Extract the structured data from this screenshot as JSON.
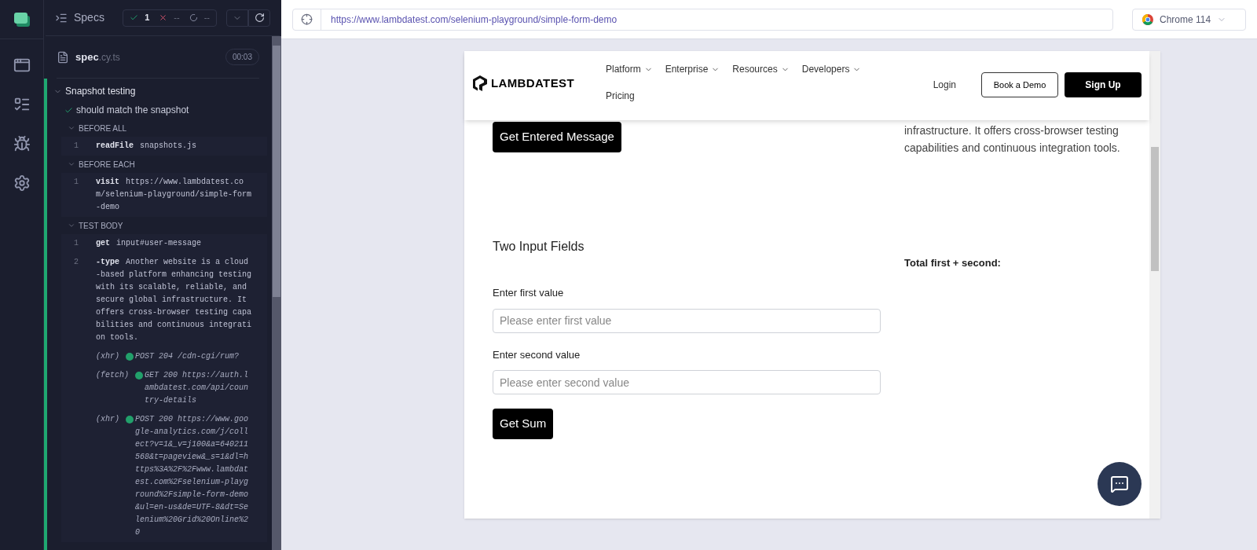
{
  "reporter": {
    "title": "Specs",
    "passed": "1",
    "failed": "--",
    "pending": "--",
    "spec": {
      "name": "spec",
      "ext": ".cy.ts",
      "duration": "00:03"
    },
    "suite": {
      "title": "Snapshot testing",
      "expanded": true
    },
    "test": {
      "title": "should match the snapshot",
      "passed": true
    },
    "hooks": [
      {
        "title": "BEFORE ALL",
        "expanded": true,
        "commands": [
          {
            "kind": "command",
            "number": "1",
            "name": "readFile",
            "message": "snapshots.js"
          }
        ]
      },
      {
        "title": "BEFORE EACH",
        "expanded": true,
        "commands": [
          {
            "kind": "command",
            "number": "1",
            "name": "visit",
            "message": "https://www.lambdatest.com/selenium-playground/simple-form-demo"
          }
        ]
      },
      {
        "title": "TEST BODY",
        "expanded": true,
        "commands": [
          {
            "kind": "command",
            "number": "1",
            "name": "get",
            "message": "input#user-message"
          },
          {
            "kind": "command",
            "number": "2",
            "name": "-type",
            "message": "Another website is a cloud-based platform enhancing testing with its scalable, reliable, and secure global infrastructure. It offers cross-browser testing capabilities and continuous integration tools."
          },
          {
            "kind": "request",
            "source": "(xhr)",
            "color": "#22a06b",
            "message": "POST 204 /cdn-cgi/rum?"
          },
          {
            "kind": "request",
            "source": "(fetch)",
            "color": "#22a06b",
            "message": "GET 200 https://auth.lambdatest.com/api/country-details"
          },
          {
            "kind": "request",
            "source": "(xhr)",
            "color": "#22a06b",
            "message": "POST 200 https://www.google-analytics.com/j/collect?v=1&_v=j100&a=640211568&t=pageview&_s=1&dl=https%3A%2F%2Fwww.lambdatest.com%2Fselenium-playground%2Fsimple-form-demo&ul=en-us&de=UTF-8&dt=Selenium%20Grid%20Online%20"
          }
        ]
      }
    ]
  },
  "browser": {
    "url": "https://www.lambdatest.com/selenium-playground/simple-form-demo",
    "name": "Chrome 114"
  },
  "site": {
    "brand": "LAMBDATEST",
    "nav": [
      {
        "label": "Platform",
        "dropdown": true
      },
      {
        "label": "Enterprise",
        "dropdown": true
      },
      {
        "label": "Resources",
        "dropdown": true
      },
      {
        "label": "Developers",
        "dropdown": true
      },
      {
        "label": "Pricing",
        "dropdown": false
      }
    ],
    "login": "Login",
    "demo_button": "Book a Demo",
    "signup_button": "Sign Up",
    "message_button": "Get Entered Message",
    "message_text": "infrastructure. It offers cross-browser testing capabilities and continuous integration tools.",
    "section_title": "Two Input Fields",
    "fields": [
      {
        "label": "Enter first value",
        "placeholder": "Please enter first value"
      },
      {
        "label": "Enter second value",
        "placeholder": "Please enter second value"
      }
    ],
    "sum_button": "Get Sum",
    "total_label": "Total first + second:"
  }
}
